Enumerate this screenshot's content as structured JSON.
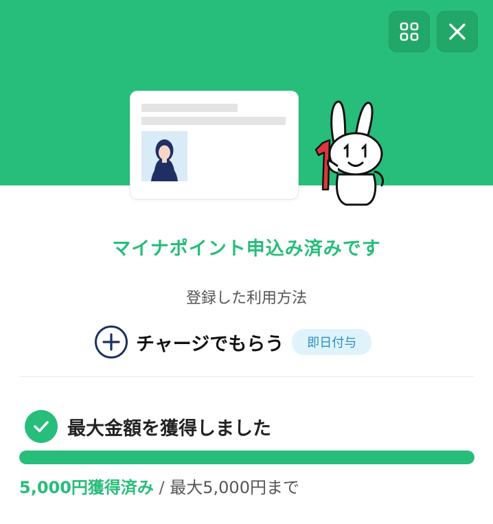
{
  "header": {
    "menu_icon": "grid-icon",
    "close_icon": "close-icon"
  },
  "illustration": {
    "card_icon": "my-number-card-icon",
    "mascot_icon": "mynumber-rabbit-mascot-icon"
  },
  "main": {
    "title": "マイナポイント申込み済みです",
    "subtitle": "登録した利用方法",
    "method_label": "チャージでもらう",
    "method_badge": "即日付与"
  },
  "status": {
    "label": "最大金額を獲得しました",
    "progress": 1.0,
    "earned_text": "5,000円獲得済み",
    "separator": " / ",
    "max_text": "最大5,000円まで"
  },
  "colors": {
    "brand_green": "#27bd7a",
    "badge_bg": "#dff3fb",
    "badge_text": "#2a8fc2",
    "plus_ring": "#1d2f5e"
  }
}
